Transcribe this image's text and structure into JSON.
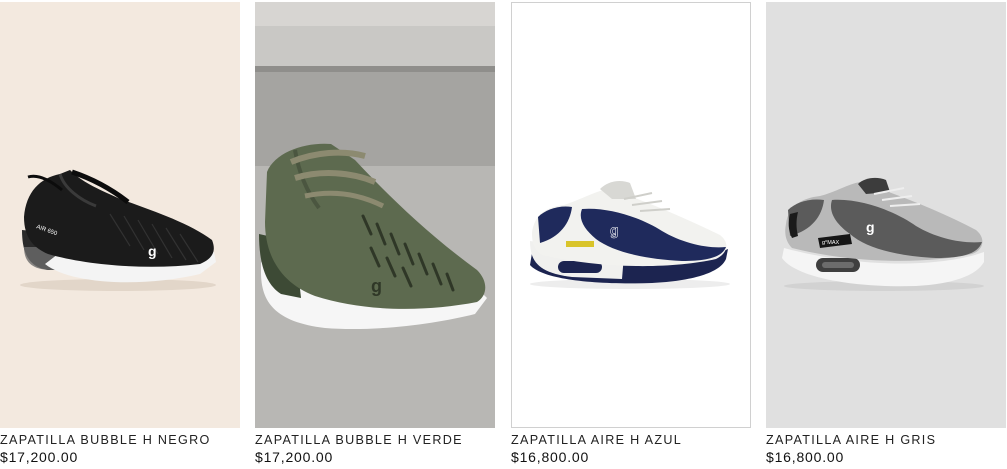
{
  "products": [
    {
      "name": "ZAPATILLA BUBBLE H NEGRO",
      "price": "$17,200.00",
      "background": "#f3e9df",
      "shoe_color": "#1b1b1b"
    },
    {
      "name": "ZAPATILLA BUBBLE H VERDE",
      "price": "$17,200.00",
      "background": "#b4b4b2",
      "shoe_color": "#5d6a4f"
    },
    {
      "name": "ZAPATILLA AIRE H AZUL",
      "price": "$16,800.00",
      "background": "#ffffff",
      "shoe_color": "#1f2a5c"
    },
    {
      "name": "ZAPATILLA AIRE H GRIS",
      "price": "$16,800.00",
      "background": "#e0e0e0",
      "shoe_color": "#5b5b5b"
    }
  ],
  "brand_mark": "g",
  "sole_labels": [
    "AIR 650",
    "g°MAX"
  ]
}
